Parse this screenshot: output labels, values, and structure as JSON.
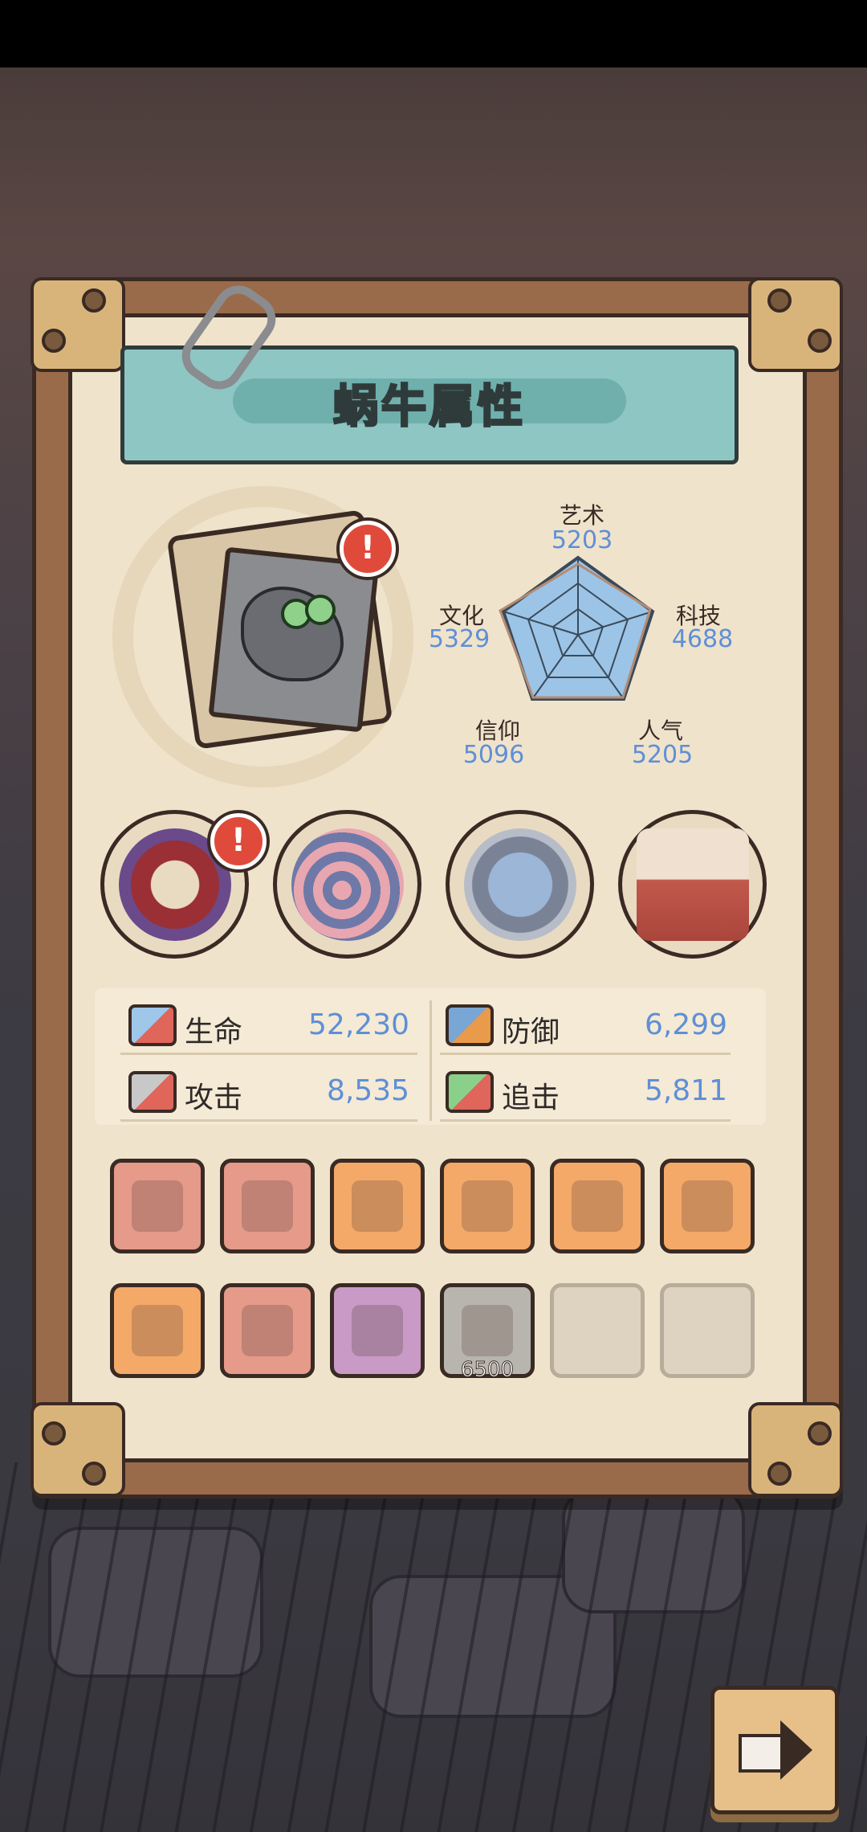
{
  "title": "蜗牛属性",
  "radar": {
    "labels": [
      {
        "name": "艺术",
        "value": "5203"
      },
      {
        "name": "科技",
        "value": "4688"
      },
      {
        "name": "人气",
        "value": "5205"
      },
      {
        "name": "信仰",
        "value": "5096"
      },
      {
        "name": "文化",
        "value": "5329"
      }
    ]
  },
  "skills": [
    {
      "icon": "thorn-ring-icon",
      "alert": true
    },
    {
      "icon": "snail-shell-icon",
      "alert": false
    },
    {
      "icon": "compass-icon",
      "alert": false
    },
    {
      "icon": "potion-crate-icon",
      "alert": false
    }
  ],
  "stats": {
    "hp_label": "生命",
    "hp_value": "52,230",
    "def_label": "防御",
    "def_value": "6,299",
    "atk_label": "攻击",
    "atk_value": "8,535",
    "pursuit_label": "追击",
    "pursuit_value": "5,811"
  },
  "equipment": {
    "row1": [
      {
        "icon": "dagger-icon",
        "rarity": "red"
      },
      {
        "icon": "gauntlet-icon",
        "rarity": "red"
      },
      {
        "icon": "goggles-icon",
        "rarity": "orange"
      },
      {
        "icon": "crossed-swords-icon",
        "rarity": "orange"
      },
      {
        "icon": "ring-icon",
        "rarity": "orange"
      },
      {
        "icon": "amulet-icon",
        "rarity": "orange"
      }
    ],
    "row2": [
      {
        "icon": "scythe-icon",
        "rarity": "orange"
      },
      {
        "icon": "slingshot-icon",
        "rarity": "red"
      },
      {
        "icon": "armor-vest-icon",
        "rarity": "purple"
      },
      {
        "icon": "scroll-icon",
        "rarity": "gray",
        "cost": "6500"
      },
      {
        "icon": "",
        "rarity": "empty"
      },
      {
        "icon": "",
        "rarity": "empty"
      }
    ]
  },
  "badge_text": "!",
  "next_button": "arrow-right-icon"
}
